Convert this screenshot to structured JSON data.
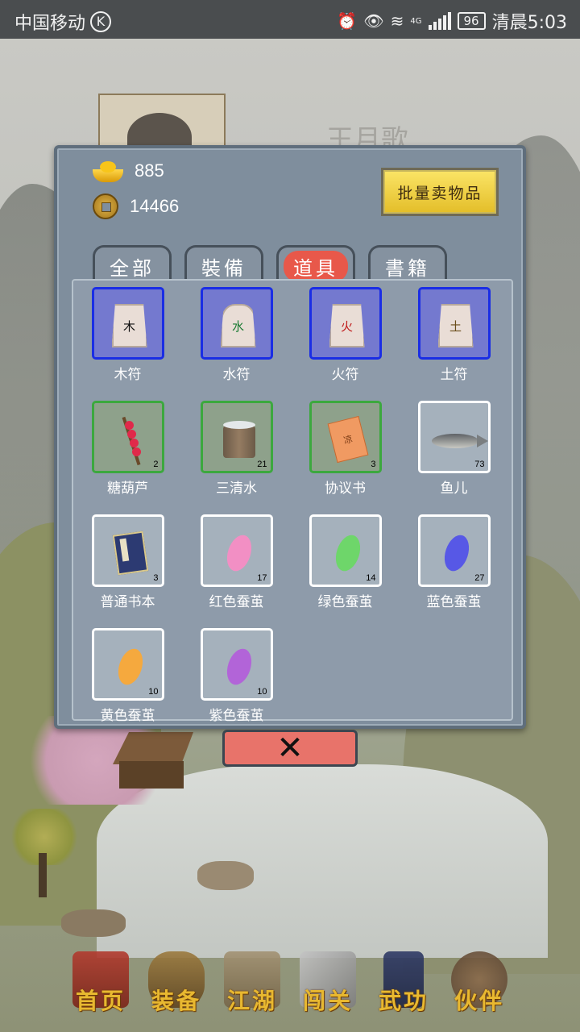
{
  "status_bar": {
    "carrier": "中国移动",
    "carrier_icon": "K",
    "network": "4G",
    "battery": "96",
    "time": "清晨5:03"
  },
  "background": {
    "character_name": "王月歌"
  },
  "dialog": {
    "gold_amount": "885",
    "coin_amount": "14466",
    "sell_button_label": "批量卖物品",
    "tabs": [
      {
        "label": "全部",
        "active": false
      },
      {
        "label": "裝備",
        "active": false
      },
      {
        "label": "道具",
        "active": true
      },
      {
        "label": "書籍",
        "active": false
      }
    ],
    "items": [
      {
        "name": "木符",
        "count": "",
        "rarity": "blue",
        "glyph": "木"
      },
      {
        "name": "水符",
        "count": "",
        "rarity": "blue",
        "glyph": "水"
      },
      {
        "name": "火符",
        "count": "",
        "rarity": "blue",
        "glyph": "火"
      },
      {
        "name": "土符",
        "count": "",
        "rarity": "blue",
        "glyph": "土"
      },
      {
        "name": "糖葫芦",
        "count": "2",
        "rarity": "green"
      },
      {
        "name": "三清水",
        "count": "21",
        "rarity": "green"
      },
      {
        "name": "协议书",
        "count": "3",
        "rarity": "green",
        "glyph": "凉"
      },
      {
        "name": "鱼儿",
        "count": "73",
        "rarity": "white"
      },
      {
        "name": "普通书本",
        "count": "3",
        "rarity": "white"
      },
      {
        "name": "红色蚕茧",
        "count": "17",
        "rarity": "white",
        "color": "#f28fc4"
      },
      {
        "name": "绿色蚕茧",
        "count": "14",
        "rarity": "white",
        "color": "#6ed66a"
      },
      {
        "name": "蓝色蚕茧",
        "count": "27",
        "rarity": "white",
        "color": "#5758e6"
      },
      {
        "name": "黄色蚕茧",
        "count": "10",
        "rarity": "white",
        "color": "#f5a93e"
      },
      {
        "name": "紫色蚕茧",
        "count": "10",
        "rarity": "white",
        "color": "#b264d8"
      }
    ],
    "close_label": "✕"
  },
  "bottom_nav": [
    {
      "label": "首页",
      "icon": "temple-icon"
    },
    {
      "label": "装备",
      "icon": "armor-icon"
    },
    {
      "label": "江湖",
      "icon": "scroll-icon"
    },
    {
      "label": "闯关",
      "icon": "swords-icon"
    },
    {
      "label": "武功",
      "icon": "book-icon"
    },
    {
      "label": "伙伴",
      "icon": "companions-icon"
    }
  ],
  "colors": {
    "rarity_blue": "#1a2de5",
    "rarity_green": "#3ca83e",
    "rarity_white": "#ffffff",
    "active_tab": "#e8584a",
    "sell_button": "#f5d43c",
    "close_button": "#e8736a",
    "nav_label": "#e8b830"
  }
}
